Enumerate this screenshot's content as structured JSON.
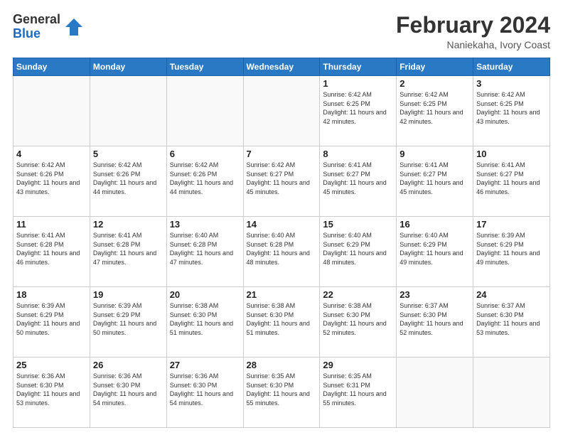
{
  "header": {
    "logo_general": "General",
    "logo_blue": "Blue",
    "month_title": "February 2024",
    "subtitle": "Naniekaha, Ivory Coast"
  },
  "days_of_week": [
    "Sunday",
    "Monday",
    "Tuesday",
    "Wednesday",
    "Thursday",
    "Friday",
    "Saturday"
  ],
  "weeks": [
    [
      {
        "day": "",
        "info": ""
      },
      {
        "day": "",
        "info": ""
      },
      {
        "day": "",
        "info": ""
      },
      {
        "day": "",
        "info": ""
      },
      {
        "day": "1",
        "info": "Sunrise: 6:42 AM\nSunset: 6:25 PM\nDaylight: 11 hours\nand 42 minutes."
      },
      {
        "day": "2",
        "info": "Sunrise: 6:42 AM\nSunset: 6:25 PM\nDaylight: 11 hours\nand 42 minutes."
      },
      {
        "day": "3",
        "info": "Sunrise: 6:42 AM\nSunset: 6:25 PM\nDaylight: 11 hours\nand 43 minutes."
      }
    ],
    [
      {
        "day": "4",
        "info": "Sunrise: 6:42 AM\nSunset: 6:26 PM\nDaylight: 11 hours\nand 43 minutes."
      },
      {
        "day": "5",
        "info": "Sunrise: 6:42 AM\nSunset: 6:26 PM\nDaylight: 11 hours\nand 44 minutes."
      },
      {
        "day": "6",
        "info": "Sunrise: 6:42 AM\nSunset: 6:26 PM\nDaylight: 11 hours\nand 44 minutes."
      },
      {
        "day": "7",
        "info": "Sunrise: 6:42 AM\nSunset: 6:27 PM\nDaylight: 11 hours\nand 45 minutes."
      },
      {
        "day": "8",
        "info": "Sunrise: 6:41 AM\nSunset: 6:27 PM\nDaylight: 11 hours\nand 45 minutes."
      },
      {
        "day": "9",
        "info": "Sunrise: 6:41 AM\nSunset: 6:27 PM\nDaylight: 11 hours\nand 45 minutes."
      },
      {
        "day": "10",
        "info": "Sunrise: 6:41 AM\nSunset: 6:27 PM\nDaylight: 11 hours\nand 46 minutes."
      }
    ],
    [
      {
        "day": "11",
        "info": "Sunrise: 6:41 AM\nSunset: 6:28 PM\nDaylight: 11 hours\nand 46 minutes."
      },
      {
        "day": "12",
        "info": "Sunrise: 6:41 AM\nSunset: 6:28 PM\nDaylight: 11 hours\nand 47 minutes."
      },
      {
        "day": "13",
        "info": "Sunrise: 6:40 AM\nSunset: 6:28 PM\nDaylight: 11 hours\nand 47 minutes."
      },
      {
        "day": "14",
        "info": "Sunrise: 6:40 AM\nSunset: 6:28 PM\nDaylight: 11 hours\nand 48 minutes."
      },
      {
        "day": "15",
        "info": "Sunrise: 6:40 AM\nSunset: 6:29 PM\nDaylight: 11 hours\nand 48 minutes."
      },
      {
        "day": "16",
        "info": "Sunrise: 6:40 AM\nSunset: 6:29 PM\nDaylight: 11 hours\nand 49 minutes."
      },
      {
        "day": "17",
        "info": "Sunrise: 6:39 AM\nSunset: 6:29 PM\nDaylight: 11 hours\nand 49 minutes."
      }
    ],
    [
      {
        "day": "18",
        "info": "Sunrise: 6:39 AM\nSunset: 6:29 PM\nDaylight: 11 hours\nand 50 minutes."
      },
      {
        "day": "19",
        "info": "Sunrise: 6:39 AM\nSunset: 6:29 PM\nDaylight: 11 hours\nand 50 minutes."
      },
      {
        "day": "20",
        "info": "Sunrise: 6:38 AM\nSunset: 6:30 PM\nDaylight: 11 hours\nand 51 minutes."
      },
      {
        "day": "21",
        "info": "Sunrise: 6:38 AM\nSunset: 6:30 PM\nDaylight: 11 hours\nand 51 minutes."
      },
      {
        "day": "22",
        "info": "Sunrise: 6:38 AM\nSunset: 6:30 PM\nDaylight: 11 hours\nand 52 minutes."
      },
      {
        "day": "23",
        "info": "Sunrise: 6:37 AM\nSunset: 6:30 PM\nDaylight: 11 hours\nand 52 minutes."
      },
      {
        "day": "24",
        "info": "Sunrise: 6:37 AM\nSunset: 6:30 PM\nDaylight: 11 hours\nand 53 minutes."
      }
    ],
    [
      {
        "day": "25",
        "info": "Sunrise: 6:36 AM\nSunset: 6:30 PM\nDaylight: 11 hours\nand 53 minutes."
      },
      {
        "day": "26",
        "info": "Sunrise: 6:36 AM\nSunset: 6:30 PM\nDaylight: 11 hours\nand 54 minutes."
      },
      {
        "day": "27",
        "info": "Sunrise: 6:36 AM\nSunset: 6:30 PM\nDaylight: 11 hours\nand 54 minutes."
      },
      {
        "day": "28",
        "info": "Sunrise: 6:35 AM\nSunset: 6:30 PM\nDaylight: 11 hours\nand 55 minutes."
      },
      {
        "day": "29",
        "info": "Sunrise: 6:35 AM\nSunset: 6:31 PM\nDaylight: 11 hours\nand 55 minutes."
      },
      {
        "day": "",
        "info": ""
      },
      {
        "day": "",
        "info": ""
      }
    ]
  ]
}
